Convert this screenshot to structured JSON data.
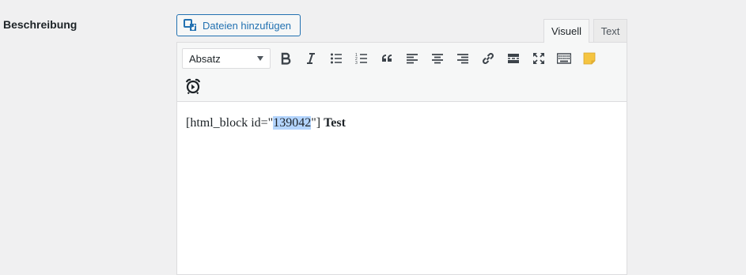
{
  "field": {
    "label": "Beschreibung"
  },
  "media_button": {
    "label": "Dateien hinzufügen",
    "icon": "add-media-icon"
  },
  "tabs": {
    "visual": "Visuell",
    "text": "Text"
  },
  "toolbar": {
    "format_select": "Absatz",
    "buttons": [
      "bold-icon",
      "italic-icon",
      "bullet-list-icon",
      "numbered-list-icon",
      "blockquote-icon",
      "align-left-icon",
      "align-center-icon",
      "align-right-icon",
      "link-icon",
      "read-more-icon",
      "fullscreen-icon",
      "toolbar-toggle-icon",
      "note-icon",
      "clock-icon"
    ]
  },
  "editor": {
    "text_before": "[html_block id=\"",
    "text_selected": "139042",
    "text_after": "\"] ",
    "text_bold": "Test"
  },
  "colors": {
    "accent": "#2271b1",
    "selection": "#b4d5fe",
    "note": "#f5c440"
  }
}
